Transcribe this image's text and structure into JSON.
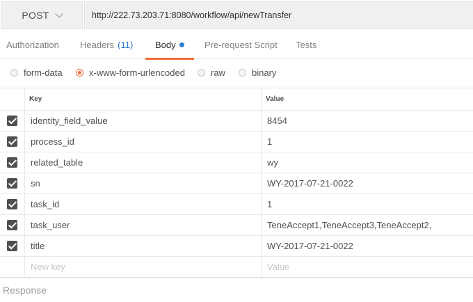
{
  "request": {
    "method": "POST",
    "url": "http://222.73.203.71:8080/workflow/api/newTransfer"
  },
  "tabs": {
    "authorization": "Authorization",
    "headers": "Headers",
    "headers_count": "(11)",
    "body": "Body",
    "prerequest": "Pre-request Script",
    "tests": "Tests"
  },
  "body_types": {
    "form_data": "form-data",
    "urlencoded": "x-www-form-urlencoded",
    "raw": "raw",
    "binary": "binary",
    "selected": "x-www-form-urlencoded"
  },
  "table": {
    "key_header": "Key",
    "value_header": "Value",
    "rows": [
      {
        "key": "identity_field_value",
        "value": "8454",
        "checked": true
      },
      {
        "key": "process_id",
        "value": "1",
        "checked": true
      },
      {
        "key": "related_table",
        "value": "wy",
        "checked": true
      },
      {
        "key": "sn",
        "value": "WY-2017-07-21-0022",
        "checked": true
      },
      {
        "key": "task_id",
        "value": "1",
        "checked": true
      },
      {
        "key": "task_user",
        "value": "TeneAccept1,TeneAccept3,TeneAccept2,",
        "checked": true
      },
      {
        "key": "title",
        "value": "WY-2017-07-21-0022",
        "checked": true
      }
    ],
    "new_key_placeholder": "New key",
    "new_value_placeholder": "Value"
  },
  "response": {
    "label": "Response"
  },
  "colors": {
    "accent": "#f26b3a",
    "link": "#2c7bd6"
  }
}
